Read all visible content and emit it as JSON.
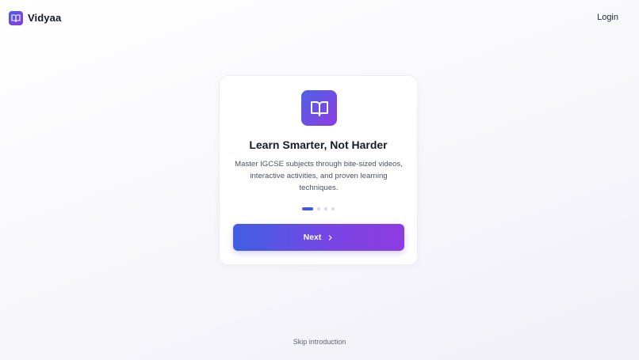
{
  "header": {
    "brand_name": "Vidyaa",
    "login_label": "Login",
    "logo_icon": "book-open-icon"
  },
  "onboarding": {
    "icon": "book-open-icon",
    "title": "Learn Smarter, Not Harder",
    "description": "Master IGCSE subjects through bite-sized videos, interactive activities, and proven learning techniques.",
    "current_step": 1,
    "total_steps": 4,
    "next_label": "Next",
    "next_icon": "chevron-right-icon"
  },
  "footer": {
    "skip_label": "Skip introduction"
  },
  "colors": {
    "accent_start": "#3f5fe3",
    "accent_end": "#8e3be1",
    "active_dot": "#3d5be0",
    "inactive_dot": "#d4d7de"
  }
}
